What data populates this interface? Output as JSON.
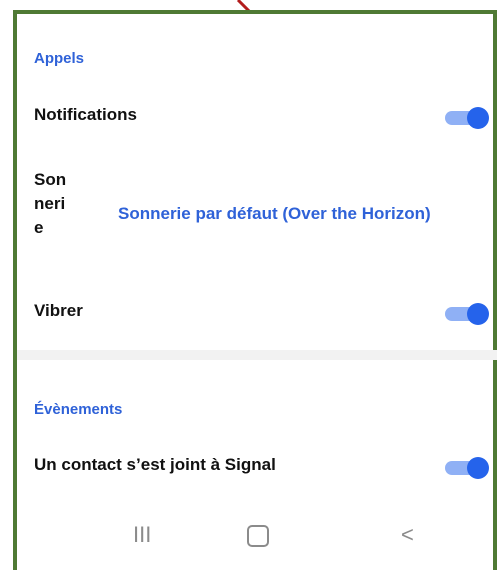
{
  "sections": [
    {
      "title": "Appels"
    },
    {
      "title": "Évènements"
    }
  ],
  "rows": {
    "notifications": {
      "label": "Notifications",
      "enabled": true
    },
    "sound": {
      "label": "Sonnerie",
      "value": "Sonnerie par défaut (Over the Horizon)"
    },
    "vibrate": {
      "label": "Vibrer",
      "enabled": true
    },
    "contact_joined": {
      "label": "Un contact s’est joint à Signal",
      "enabled": true
    }
  },
  "sound_label_lines": [
    "Son",
    "neri",
    "e"
  ],
  "navigation": {
    "recent": "III",
    "home_icon": "home-icon",
    "back": "<"
  },
  "colors": {
    "accent": "#2f62d8",
    "toggle_on": "#2563eb",
    "frame": "#4f7a34",
    "arrow": "#b31d1d"
  }
}
